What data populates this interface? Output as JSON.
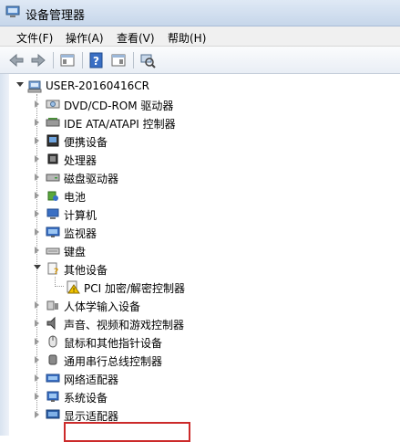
{
  "window": {
    "title": "设备管理器"
  },
  "menu": [
    {
      "label": "文件(F)"
    },
    {
      "label": "操作(A)"
    },
    {
      "label": "查看(V)"
    },
    {
      "label": "帮助(H)"
    }
  ],
  "toolbar": {
    "buttons": [
      "back-icon",
      "forward-icon",
      "properties-icon",
      "help-icon",
      "console-icon",
      "scan-hardware-icon"
    ]
  },
  "tree": {
    "root": {
      "label": "USER-20160416CR",
      "expanded": true
    },
    "items": [
      {
        "label": "DVD/CD-ROM 驱动器",
        "icon": "dvd-drive-icon"
      },
      {
        "label": "IDE ATA/ATAPI 控制器",
        "icon": "ide-controller-icon"
      },
      {
        "label": "便携设备",
        "icon": "portable-device-icon"
      },
      {
        "label": "处理器",
        "icon": "processor-icon"
      },
      {
        "label": "磁盘驱动器",
        "icon": "disk-drive-icon"
      },
      {
        "label": "电池",
        "icon": "battery-icon"
      },
      {
        "label": "计算机",
        "icon": "computer-icon"
      },
      {
        "label": "监视器",
        "icon": "monitor-icon"
      },
      {
        "label": "键盘",
        "icon": "keyboard-icon"
      },
      {
        "label": "其他设备",
        "icon": "other-devices-icon",
        "expanded": true,
        "children": [
          {
            "label": "PCI 加密/解密控制器",
            "icon": "unknown-device-warning-icon"
          }
        ]
      },
      {
        "label": "人体学输入设备",
        "icon": "hid-icon"
      },
      {
        "label": "声音、视频和游戏控制器",
        "icon": "sound-icon"
      },
      {
        "label": "鼠标和其他指针设备",
        "icon": "mouse-icon"
      },
      {
        "label": "通用串行总线控制器",
        "icon": "usb-icon",
        "highlighted": true
      },
      {
        "label": "网络适配器",
        "icon": "network-adapter-icon"
      },
      {
        "label": "系统设备",
        "icon": "system-devices-icon"
      },
      {
        "label": "显示适配器",
        "icon": "display-adapter-icon"
      }
    ]
  },
  "colors": {
    "highlight_border": "#cc2a2a",
    "title_bar": "#c6d6ea"
  }
}
